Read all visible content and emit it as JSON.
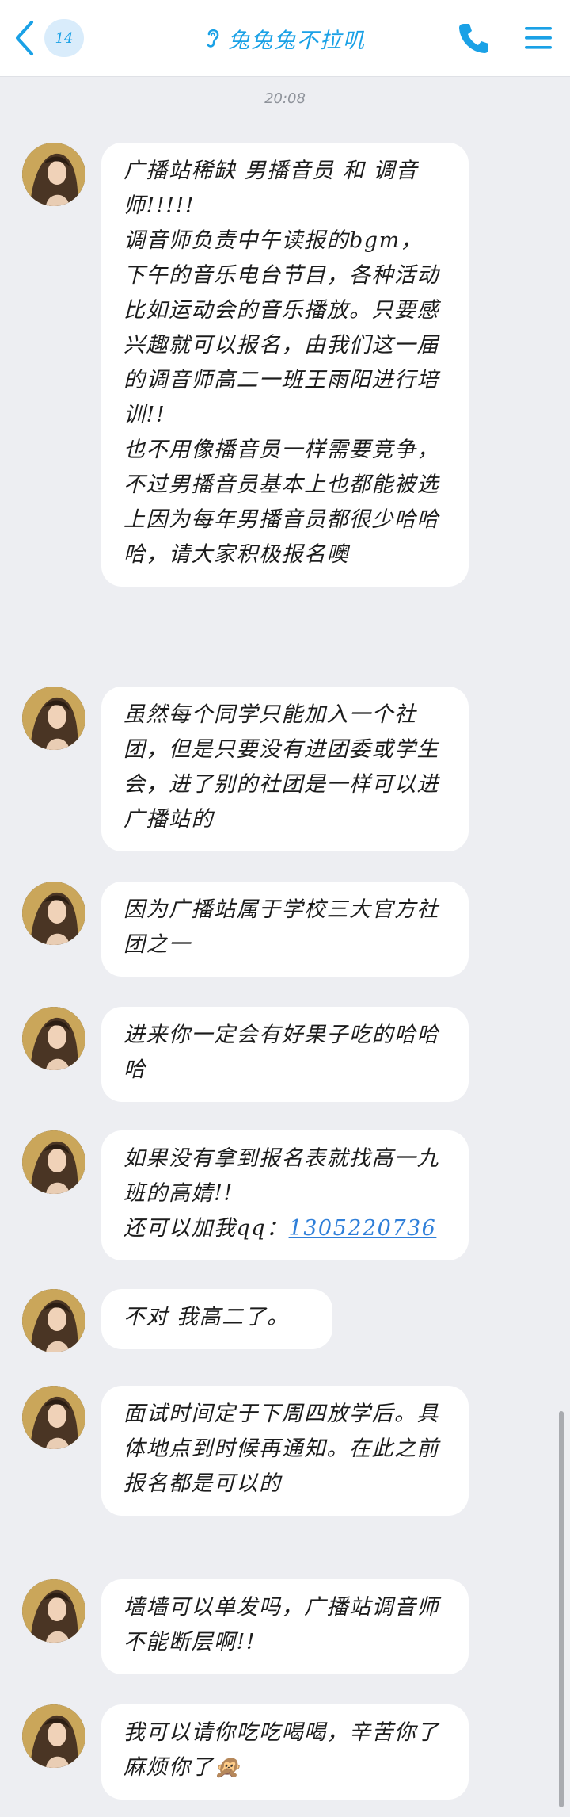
{
  "header": {
    "unread_count": "14",
    "title": "兔兔兔不拉叽",
    "icons": {
      "back": "chevron-left-icon",
      "listen": "ear-icon",
      "call": "phone-icon",
      "menu": "menu-icon"
    },
    "accent_color": "#1aa1e6"
  },
  "timestamp": "20:08",
  "messages": [
    {
      "lines": [
        "广播站稀缺 男播音员 和 调音师!!!!!",
        "调音师负责中午读报的bgm，下午的音乐电台节目，各种活动比如运动会的音乐播放。只要感兴趣就可以报名，由我们这一届的调音师高二一班王雨阳进行培训!!",
        "也不用像播音员一样需要竞争，不过男播音员基本上也都能被选上因为每年男播音员都很少哈哈哈，请大家积极报名噢"
      ]
    },
    {
      "lines": [
        "虽然每个同学只能加入一个社团，但是只要没有进团委或学生会，进了别的社团是一样可以进广播站的"
      ]
    },
    {
      "lines": [
        "因为广播站属于学校三大官方社团之一"
      ]
    },
    {
      "lines": [
        "进来你一定会有好果子吃的哈哈哈"
      ]
    },
    {
      "lines": [
        "如果没有拿到报名表就找高一九班的高婧!!",
        "还可以加我qq："
      ],
      "qq": "1305220736"
    },
    {
      "lines": [
        "不对 我高二了。"
      ]
    },
    {
      "lines": [
        "面试时间定于下周四放学后。具体地点到时候再通知。在此之前报名都是可以的"
      ]
    },
    {
      "lines": [
        "墙墙可以单发吗，广播站调音师不能断层啊!!"
      ]
    },
    {
      "lines": [
        "我可以请你吃吃喝喝，辛苦你了麻烦你了🙊"
      ]
    }
  ]
}
